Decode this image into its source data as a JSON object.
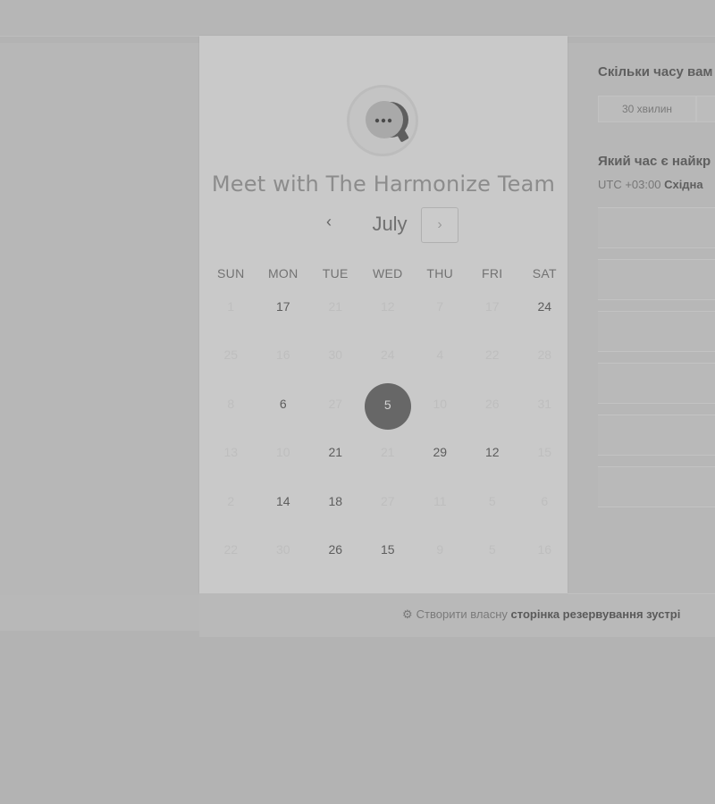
{
  "card": {
    "title": "Meet with The Harmonize Team",
    "month": "July",
    "prev_icon": "‹",
    "next_icon": "›",
    "weekdays": [
      "SUN",
      "MON",
      "TUE",
      "WED",
      "THU",
      "FRI",
      "SAT"
    ],
    "weeks": [
      [
        "1",
        "17",
        "21",
        "12",
        "7",
        "17",
        "24"
      ],
      [
        "25",
        "16",
        "30",
        "24",
        "4",
        "22",
        "28"
      ],
      [
        "8",
        "6",
        "27",
        "5",
        "10",
        "26",
        "31"
      ],
      [
        "13",
        "10",
        "21",
        "21",
        "29",
        "12",
        "15"
      ],
      [
        "2",
        "14",
        "18",
        "27",
        "11",
        "5",
        "6"
      ],
      [
        "22",
        "30",
        "26",
        "15",
        "9",
        "5",
        "16"
      ]
    ],
    "available": [
      [
        false,
        true,
        false,
        false,
        false,
        false,
        true
      ],
      [
        false,
        false,
        false,
        false,
        false,
        false,
        false
      ],
      [
        false,
        true,
        false,
        true,
        false,
        false,
        false
      ],
      [
        false,
        false,
        true,
        false,
        true,
        true,
        false
      ],
      [
        false,
        true,
        true,
        false,
        false,
        false,
        false
      ],
      [
        false,
        false,
        true,
        true,
        false,
        false,
        false
      ]
    ],
    "selected_date": "5"
  },
  "right": {
    "duration_question": "Скільки часу вам",
    "duration_option": "30 хвилин",
    "time_question": "Який час є найкр",
    "tz_prefix": "UTC +03:00",
    "tz_name": "Східна"
  },
  "footer": {
    "prefix": "Створити власну",
    "link": "сторінка резервування зустрі"
  },
  "colors": {
    "background": "#b3b3b3",
    "card": "#c9c9c9",
    "selected": "#676767"
  }
}
